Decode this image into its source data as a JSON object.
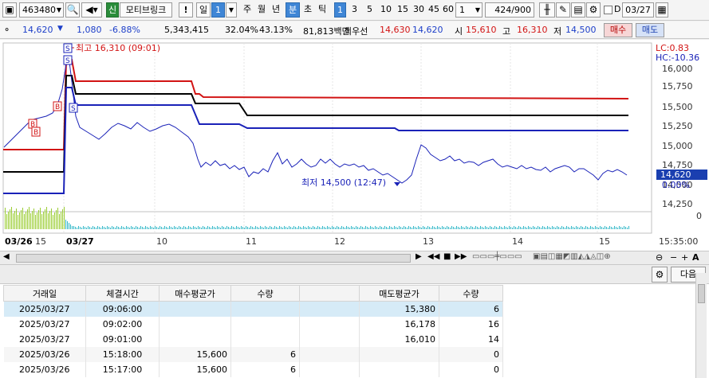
{
  "toolbar": {
    "code": "463480",
    "badge": "신",
    "stock_name": "모티브링크",
    "excl": "!",
    "period_day": "일",
    "period_num": "1",
    "period_week": "주",
    "period_month": "월",
    "period_year": "년",
    "period_min": "분",
    "period_sec": "초",
    "period_tick": "틱",
    "intervals": [
      "1",
      "3",
      "5",
      "10",
      "15",
      "30",
      "45",
      "60"
    ],
    "count_select": "1",
    "count_display": "424/900",
    "checkbox_label": "D",
    "date_value": "03/27"
  },
  "quote": {
    "price": "14,620",
    "change": "1,080",
    "change_pct": "-6.88%",
    "volume": "5,343,415",
    "ratio1": "32.04%",
    "ratio2": "43.13%",
    "amount": "81,813백만",
    "best_label": "최우선",
    "best_ask": "14,630",
    "best_bid": "14,620",
    "open_label": "시",
    "open": "15,610",
    "high_label": "고",
    "high": "16,310",
    "low_label": "저",
    "low": "14,500",
    "buy_button": "매수",
    "sell_button": "매도"
  },
  "chart": {
    "high_annotation": "최고 16,310 (09:01)",
    "low_annotation": "최저 14,500 (12:47)",
    "lc_label": "LC:0.83",
    "hc_label": "HC:-10.36",
    "y_ticks": [
      "16,000",
      "15,750",
      "15,500",
      "15,250",
      "15,000",
      "14,750",
      "14,500",
      "14,250",
      "0"
    ],
    "price_tag": "14,620",
    "pct_tag": "0.00%",
    "x_labels": [
      "03/26",
      "15",
      "03/27",
      "10",
      "11",
      "12",
      "13",
      "14",
      "15"
    ],
    "time_label": "15:35:00",
    "markers": [
      "S",
      "S",
      "B",
      "B",
      "B",
      "S"
    ],
    "colors": {
      "red_line": "#d21414",
      "black_line": "#000000",
      "blue_line": "#1a22b8",
      "volume": "#9acd32",
      "volume2": "#2fb7c7"
    }
  },
  "table": {
    "next_button": "다음",
    "headers": [
      "거래일",
      "체결시간",
      "매수평균가",
      "수량",
      "",
      "매도평균가",
      "수량"
    ],
    "rows": [
      [
        "2025/03/27",
        "09:06:00",
        "",
        "",
        "",
        "15,380",
        "6"
      ],
      [
        "2025/03/27",
        "09:02:00",
        "",
        "",
        "",
        "16,178",
        "16"
      ],
      [
        "2025/03/27",
        "09:01:00",
        "",
        "",
        "",
        "16,010",
        "14"
      ],
      [
        "2025/03/26",
        "15:18:00",
        "15,600",
        "6",
        "",
        "",
        "0"
      ],
      [
        "2025/03/26",
        "15:17:00",
        "15,600",
        "6",
        "",
        "",
        "0"
      ]
    ]
  }
}
